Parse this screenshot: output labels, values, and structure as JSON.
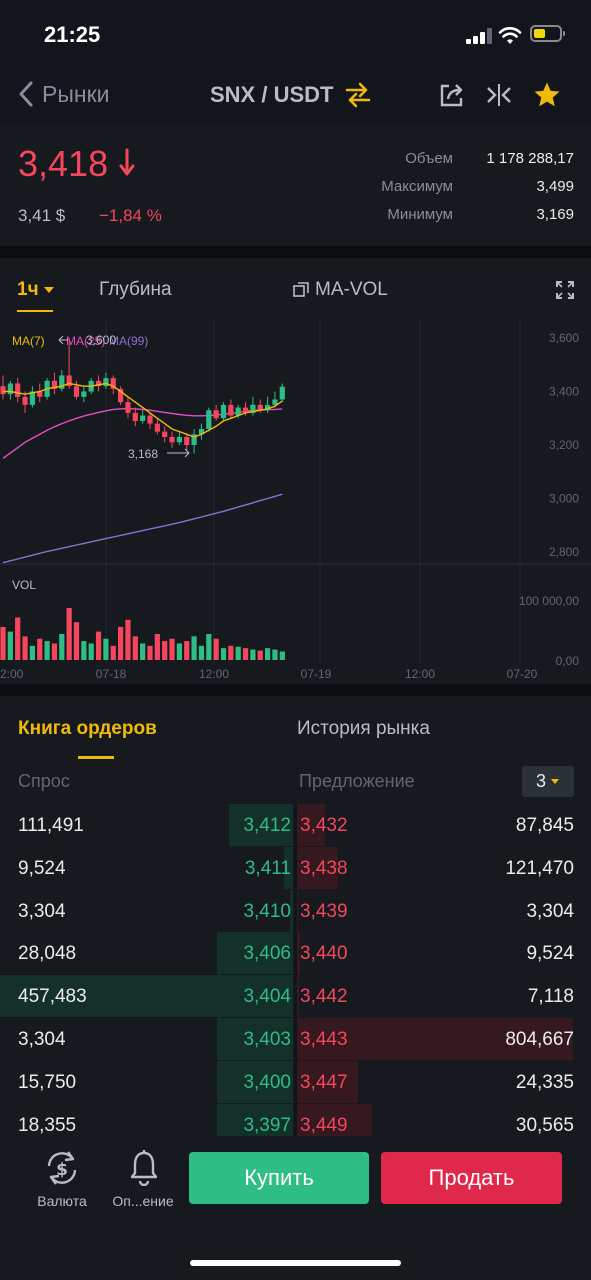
{
  "status_bar": {
    "time": "21:25"
  },
  "header": {
    "back_label": "Рынки",
    "pair": "SNX / USDT"
  },
  "price": {
    "last": "3,418",
    "usd": "3,41 $",
    "change": "−1,84 %"
  },
  "stats": [
    {
      "label": "Объем",
      "value": "1 178 288,17"
    },
    {
      "label": "Максимум",
      "value": "3,499"
    },
    {
      "label": "Минимум",
      "value": "3,169"
    }
  ],
  "chart_toolbar": {
    "interval": "1ч",
    "depth": "Глубина",
    "indicator": "MA-VOL"
  },
  "chart_data": {
    "type": "candlestick",
    "ma_legend": [
      "MA(7)",
      "MA(25)",
      "MA(99)"
    ],
    "ma_colors": [
      "#f0b90b",
      "#e74ac8",
      "#8f6ed5"
    ],
    "y_ticks": [
      "3,600",
      "3,400",
      "3,200",
      "3,000",
      "2,800"
    ],
    "ylim": [
      2800,
      3600
    ],
    "vol_label": "VOL",
    "vol_ticks": [
      "100 000,00",
      "0,00"
    ],
    "x_ticks": [
      "2:00",
      "07-18",
      "12:00",
      "07-19",
      "12:00",
      "07-20"
    ],
    "high_annotation": "3,600",
    "low_annotation": "3,168",
    "candles": [
      {
        "o": 3420,
        "c": 3390,
        "h": 3460,
        "l": 3370
      },
      {
        "o": 3390,
        "c": 3430,
        "h": 3440,
        "l": 3370
      },
      {
        "o": 3430,
        "c": 3380,
        "h": 3450,
        "l": 3360
      },
      {
        "o": 3380,
        "c": 3350,
        "h": 3400,
        "l": 3320
      },
      {
        "o": 3350,
        "c": 3400,
        "h": 3420,
        "l": 3340
      },
      {
        "o": 3400,
        "c": 3380,
        "h": 3430,
        "l": 3360
      },
      {
        "o": 3380,
        "c": 3440,
        "h": 3450,
        "l": 3370
      },
      {
        "o": 3440,
        "c": 3410,
        "h": 3470,
        "l": 3390
      },
      {
        "o": 3410,
        "c": 3460,
        "h": 3480,
        "l": 3400
      },
      {
        "o": 3460,
        "c": 3420,
        "h": 3600,
        "l": 3410
      },
      {
        "o": 3420,
        "c": 3380,
        "h": 3440,
        "l": 3370
      },
      {
        "o": 3380,
        "c": 3400,
        "h": 3420,
        "l": 3360
      },
      {
        "o": 3400,
        "c": 3440,
        "h": 3450,
        "l": 3390
      },
      {
        "o": 3440,
        "c": 3420,
        "h": 3460,
        "l": 3400
      },
      {
        "o": 3420,
        "c": 3450,
        "h": 3470,
        "l": 3410
      },
      {
        "o": 3450,
        "c": 3410,
        "h": 3460,
        "l": 3390
      },
      {
        "o": 3410,
        "c": 3360,
        "h": 3420,
        "l": 3350
      },
      {
        "o": 3360,
        "c": 3320,
        "h": 3380,
        "l": 3300
      },
      {
        "o": 3320,
        "c": 3290,
        "h": 3340,
        "l": 3270
      },
      {
        "o": 3290,
        "c": 3310,
        "h": 3330,
        "l": 3280
      },
      {
        "o": 3310,
        "c": 3280,
        "h": 3320,
        "l": 3260
      },
      {
        "o": 3280,
        "c": 3250,
        "h": 3300,
        "l": 3240
      },
      {
        "o": 3250,
        "c": 3230,
        "h": 3270,
        "l": 3210
      },
      {
        "o": 3230,
        "c": 3210,
        "h": 3250,
        "l": 3190
      },
      {
        "o": 3210,
        "c": 3230,
        "h": 3250,
        "l": 3200
      },
      {
        "o": 3230,
        "c": 3200,
        "h": 3240,
        "l": 3180
      },
      {
        "o": 3200,
        "c": 3240,
        "h": 3260,
        "l": 3168
      },
      {
        "o": 3240,
        "c": 3260,
        "h": 3280,
        "l": 3220
      },
      {
        "o": 3260,
        "c": 3330,
        "h": 3340,
        "l": 3250
      },
      {
        "o": 3330,
        "c": 3300,
        "h": 3350,
        "l": 3290
      },
      {
        "o": 3300,
        "c": 3350,
        "h": 3360,
        "l": 3290
      },
      {
        "o": 3350,
        "c": 3310,
        "h": 3370,
        "l": 3300
      },
      {
        "o": 3310,
        "c": 3340,
        "h": 3350,
        "l": 3300
      },
      {
        "o": 3340,
        "c": 3320,
        "h": 3360,
        "l": 3310
      },
      {
        "o": 3320,
        "c": 3350,
        "h": 3380,
        "l": 3310
      },
      {
        "o": 3350,
        "c": 3330,
        "h": 3370,
        "l": 3320
      },
      {
        "o": 3330,
        "c": 3350,
        "h": 3380,
        "l": 3320
      },
      {
        "o": 3350,
        "c": 3370,
        "h": 3400,
        "l": 3340
      },
      {
        "o": 3370,
        "c": 3418,
        "h": 3430,
        "l": 3360
      }
    ],
    "volumes": [
      70000,
      60000,
      90000,
      50000,
      30000,
      45000,
      40000,
      35000,
      55000,
      110000,
      80000,
      40000,
      35000,
      60000,
      45000,
      30000,
      70000,
      85000,
      50000,
      35000,
      30000,
      55000,
      40000,
      45000,
      35000,
      40000,
      50000,
      30000,
      55000,
      45000,
      25000,
      30000,
      28000,
      25000,
      22000,
      20000,
      25000,
      22000,
      18000
    ],
    "ma7": [
      3400,
      3400,
      3395,
      3390,
      3395,
      3400,
      3410,
      3415,
      3420,
      3430,
      3425,
      3420,
      3420,
      3425,
      3430,
      3420,
      3400,
      3380,
      3360,
      3340,
      3320,
      3300,
      3280,
      3260,
      3250,
      3240,
      3230,
      3240,
      3255,
      3270,
      3290,
      3300,
      3310,
      3320,
      3325,
      3330,
      3335,
      3345,
      3365
    ],
    "ma25": [
      3150,
      3170,
      3190,
      3210,
      3225,
      3240,
      3255,
      3268,
      3280,
      3290,
      3300,
      3308,
      3315,
      3322,
      3328,
      3333,
      3335,
      3336,
      3335,
      3333,
      3330,
      3326,
      3322,
      3318,
      3314,
      3311,
      3309,
      3309,
      3310,
      3312,
      3315,
      3318,
      3322,
      3326,
      3329,
      3331,
      3332,
      3333,
      3335
    ],
    "ma99": [
      2760,
      2767,
      2774,
      2781,
      2788,
      2795,
      2802,
      2808,
      2814,
      2820,
      2826,
      2832,
      2838,
      2844,
      2850,
      2856,
      2862,
      2868,
      2874,
      2880,
      2886,
      2892,
      2898,
      2904,
      2910,
      2917,
      2924,
      2931,
      2938,
      2945,
      2952,
      2960,
      2968,
      2976,
      2984,
      2992,
      3000,
      3008,
      3016
    ]
  },
  "tabs": {
    "order_book": "Книга ордеров",
    "market_history": "История рынка"
  },
  "order_book": {
    "bid_header": "Спрос",
    "ask_header": "Предложение",
    "precision": "3",
    "rows": [
      {
        "bid_amount": "111,491",
        "bid_price": "3,412",
        "ask_price": "3,432",
        "ask_amount": "87,845",
        "bid_depth": 0.22,
        "ask_depth": 0.1
      },
      {
        "bid_amount": "9,524",
        "bid_price": "3,411",
        "ask_price": "3,438",
        "ask_amount": "121,470",
        "bid_depth": 0.03,
        "ask_depth": 0.15
      },
      {
        "bid_amount": "3,304",
        "bid_price": "3,410",
        "ask_price": "3,439",
        "ask_amount": "3,304",
        "bid_depth": 0.01,
        "ask_depth": 0.005
      },
      {
        "bid_amount": "28,048",
        "bid_price": "3,406",
        "ask_price": "3,440",
        "ask_amount": "9,524",
        "bid_depth": 0.26,
        "ask_depth": 0.012
      },
      {
        "bid_amount": "457,483",
        "bid_price": "3,404",
        "ask_price": "3,442",
        "ask_amount": "7,118",
        "bid_depth": 1.0,
        "ask_depth": 0.009
      },
      {
        "bid_amount": "3,304",
        "bid_price": "3,403",
        "ask_price": "3,443",
        "ask_amount": "804,667",
        "bid_depth": 0.26,
        "ask_depth": 1.0
      },
      {
        "bid_amount": "15,750",
        "bid_price": "3,400",
        "ask_price": "3,447",
        "ask_amount": "24,335",
        "bid_depth": 0.26,
        "ask_depth": 0.22
      },
      {
        "bid_amount": "18,355",
        "bid_price": "3,397",
        "ask_price": "3,449",
        "ask_amount": "30,565",
        "bid_depth": 0.26,
        "ask_depth": 0.27
      }
    ]
  },
  "bottom_bar": {
    "currency_label": "Валюта",
    "alert_label": "Оп...ение",
    "buy_label": "Купить",
    "sell_label": "Продать"
  },
  "colors": {
    "up": "#2ebd85",
    "down": "#f6465d",
    "accent": "#f0b90b",
    "buy": "#2ebd85",
    "sell": "#e0294a"
  }
}
